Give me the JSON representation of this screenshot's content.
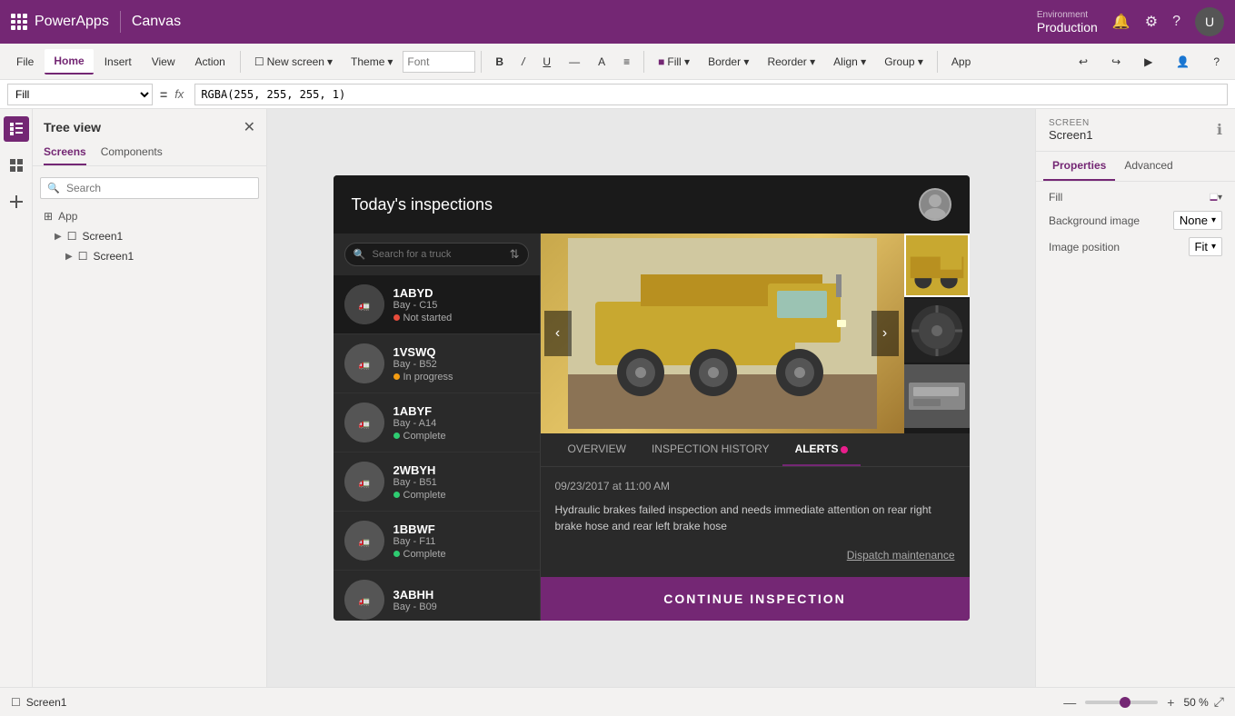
{
  "topbar": {
    "app_name": "PowerApps",
    "canvas_label": "Canvas",
    "env_label": "Environment",
    "env_name": "Production",
    "app_btn": "App",
    "undo_icon": "↩",
    "redo_icon": "↪",
    "run_icon": "▶",
    "user_icon": "👤",
    "help_icon": "?",
    "bell_icon": "🔔",
    "settings_icon": "⚙",
    "avatar_text": "U"
  },
  "ribbon": {
    "tabs": [
      "File",
      "Home",
      "Insert",
      "View",
      "Action"
    ],
    "active_tab": "Home",
    "new_screen_label": "New screen",
    "theme_label": "Theme",
    "bold_label": "B",
    "italic_label": "/",
    "underline_label": "U",
    "strikethrough_label": "—",
    "font_color_label": "A",
    "align_label": "≡",
    "fill_label": "Fill",
    "border_label": "Border",
    "reorder_label": "Reorder",
    "align_btn_label": "Align",
    "group_label": "Group"
  },
  "formula_bar": {
    "property": "Fill",
    "fx_label": "fx",
    "formula": "RGBA(255, 255, 255, 1)"
  },
  "sidebar": {
    "title": "Tree view",
    "close_icon": "✕",
    "tabs": [
      "Screens",
      "Components"
    ],
    "active_tab": "Screens",
    "search_placeholder": "Search",
    "app_label": "App",
    "screens": [
      {
        "name": "Screen1",
        "indent": 1
      },
      {
        "name": "Screen1",
        "indent": 2
      }
    ]
  },
  "app": {
    "title": "Today's inspections",
    "search_placeholder": "Search for a truck",
    "trucks": [
      {
        "name": "1ABYD",
        "bay": "Bay - C15",
        "status": "Not started",
        "status_type": "red"
      },
      {
        "name": "1VSWQ",
        "bay": "Bay - B52",
        "status": "In progress",
        "status_type": "yellow"
      },
      {
        "name": "1ABYF",
        "bay": "Bay - A14",
        "status": "Complete",
        "status_type": "green"
      },
      {
        "name": "2WBYH",
        "bay": "Bay - B51",
        "status": "Complete",
        "status_type": "green"
      },
      {
        "name": "1BBWF",
        "bay": "Bay - F11",
        "status": "Complete",
        "status_type": "green"
      },
      {
        "name": "3ABHH",
        "bay": "Bay - B09",
        "status": "",
        "status_type": ""
      }
    ],
    "detail": {
      "tabs": [
        "OVERVIEW",
        "INSPECTION HISTORY",
        "ALERTS"
      ],
      "active_tab": "ALERTS",
      "alert_date": "09/23/2017 at 11:00 AM",
      "alert_text": "Hydraulic brakes failed inspection and needs immediate attention on rear right brake hose and rear left brake hose",
      "dispatch_link": "Dispatch maintenance",
      "continue_btn": "CONTINUE INSPECTION"
    }
  },
  "right_panel": {
    "screen_label": "SCREEN",
    "screen_name": "Screen1",
    "tabs": [
      "Properties",
      "Advanced"
    ],
    "active_tab": "Properties",
    "fill_label": "Fill",
    "bg_image_label": "Background image",
    "bg_image_value": "None",
    "image_position_label": "Image position",
    "image_position_value": "Fit"
  },
  "bottom_bar": {
    "screen_label": "Screen1",
    "zoom_minus": "—",
    "zoom_plus": "+",
    "zoom_value": "50 %",
    "expand_icon": "⤢"
  }
}
